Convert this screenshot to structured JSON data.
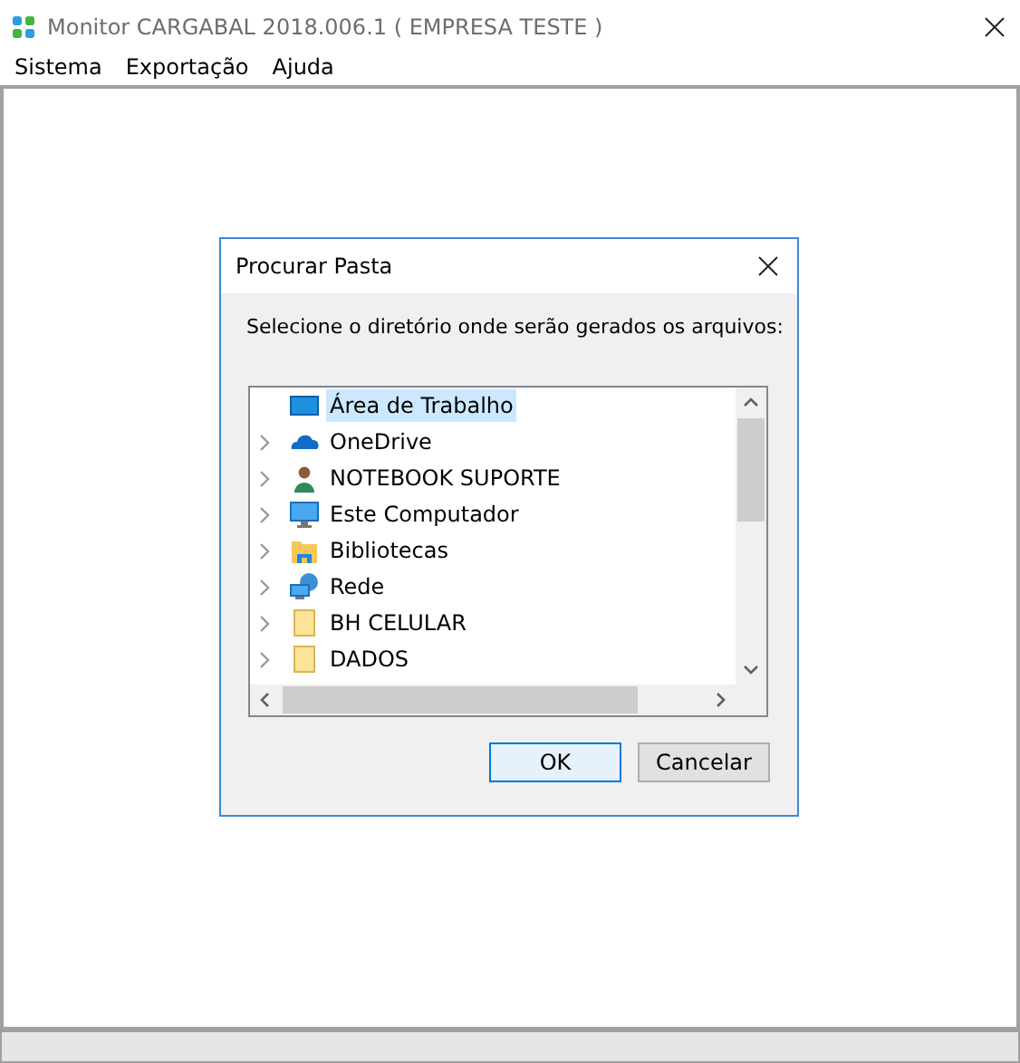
{
  "window": {
    "title": "Monitor CARGABAL 2018.006.1 ( EMPRESA TESTE )"
  },
  "menu": [
    "Sistema",
    "Exportação",
    "Ajuda"
  ],
  "dialog": {
    "title": "Procurar Pasta",
    "prompt": "Selecione o diretório onde serão gerados os arquivos:",
    "tree": [
      {
        "label": "Área de Trabalho",
        "kind": "desktop",
        "selected": true,
        "expandable": false
      },
      {
        "label": "OneDrive",
        "kind": "cloud",
        "selected": false,
        "expandable": true
      },
      {
        "label": "NOTEBOOK SUPORTE",
        "kind": "user",
        "selected": false,
        "expandable": true
      },
      {
        "label": "Este Computador",
        "kind": "computer",
        "selected": false,
        "expandable": true
      },
      {
        "label": "Bibliotecas",
        "kind": "library",
        "selected": false,
        "expandable": true
      },
      {
        "label": "Rede",
        "kind": "network",
        "selected": false,
        "expandable": true
      },
      {
        "label": "BH CELULAR",
        "kind": "folder",
        "selected": false,
        "expandable": true
      },
      {
        "label": "DADOS",
        "kind": "folder",
        "selected": false,
        "expandable": true
      }
    ],
    "buttons": [
      {
        "label": "OK",
        "default": true
      },
      {
        "label": "Cancelar",
        "default": false
      }
    ]
  }
}
